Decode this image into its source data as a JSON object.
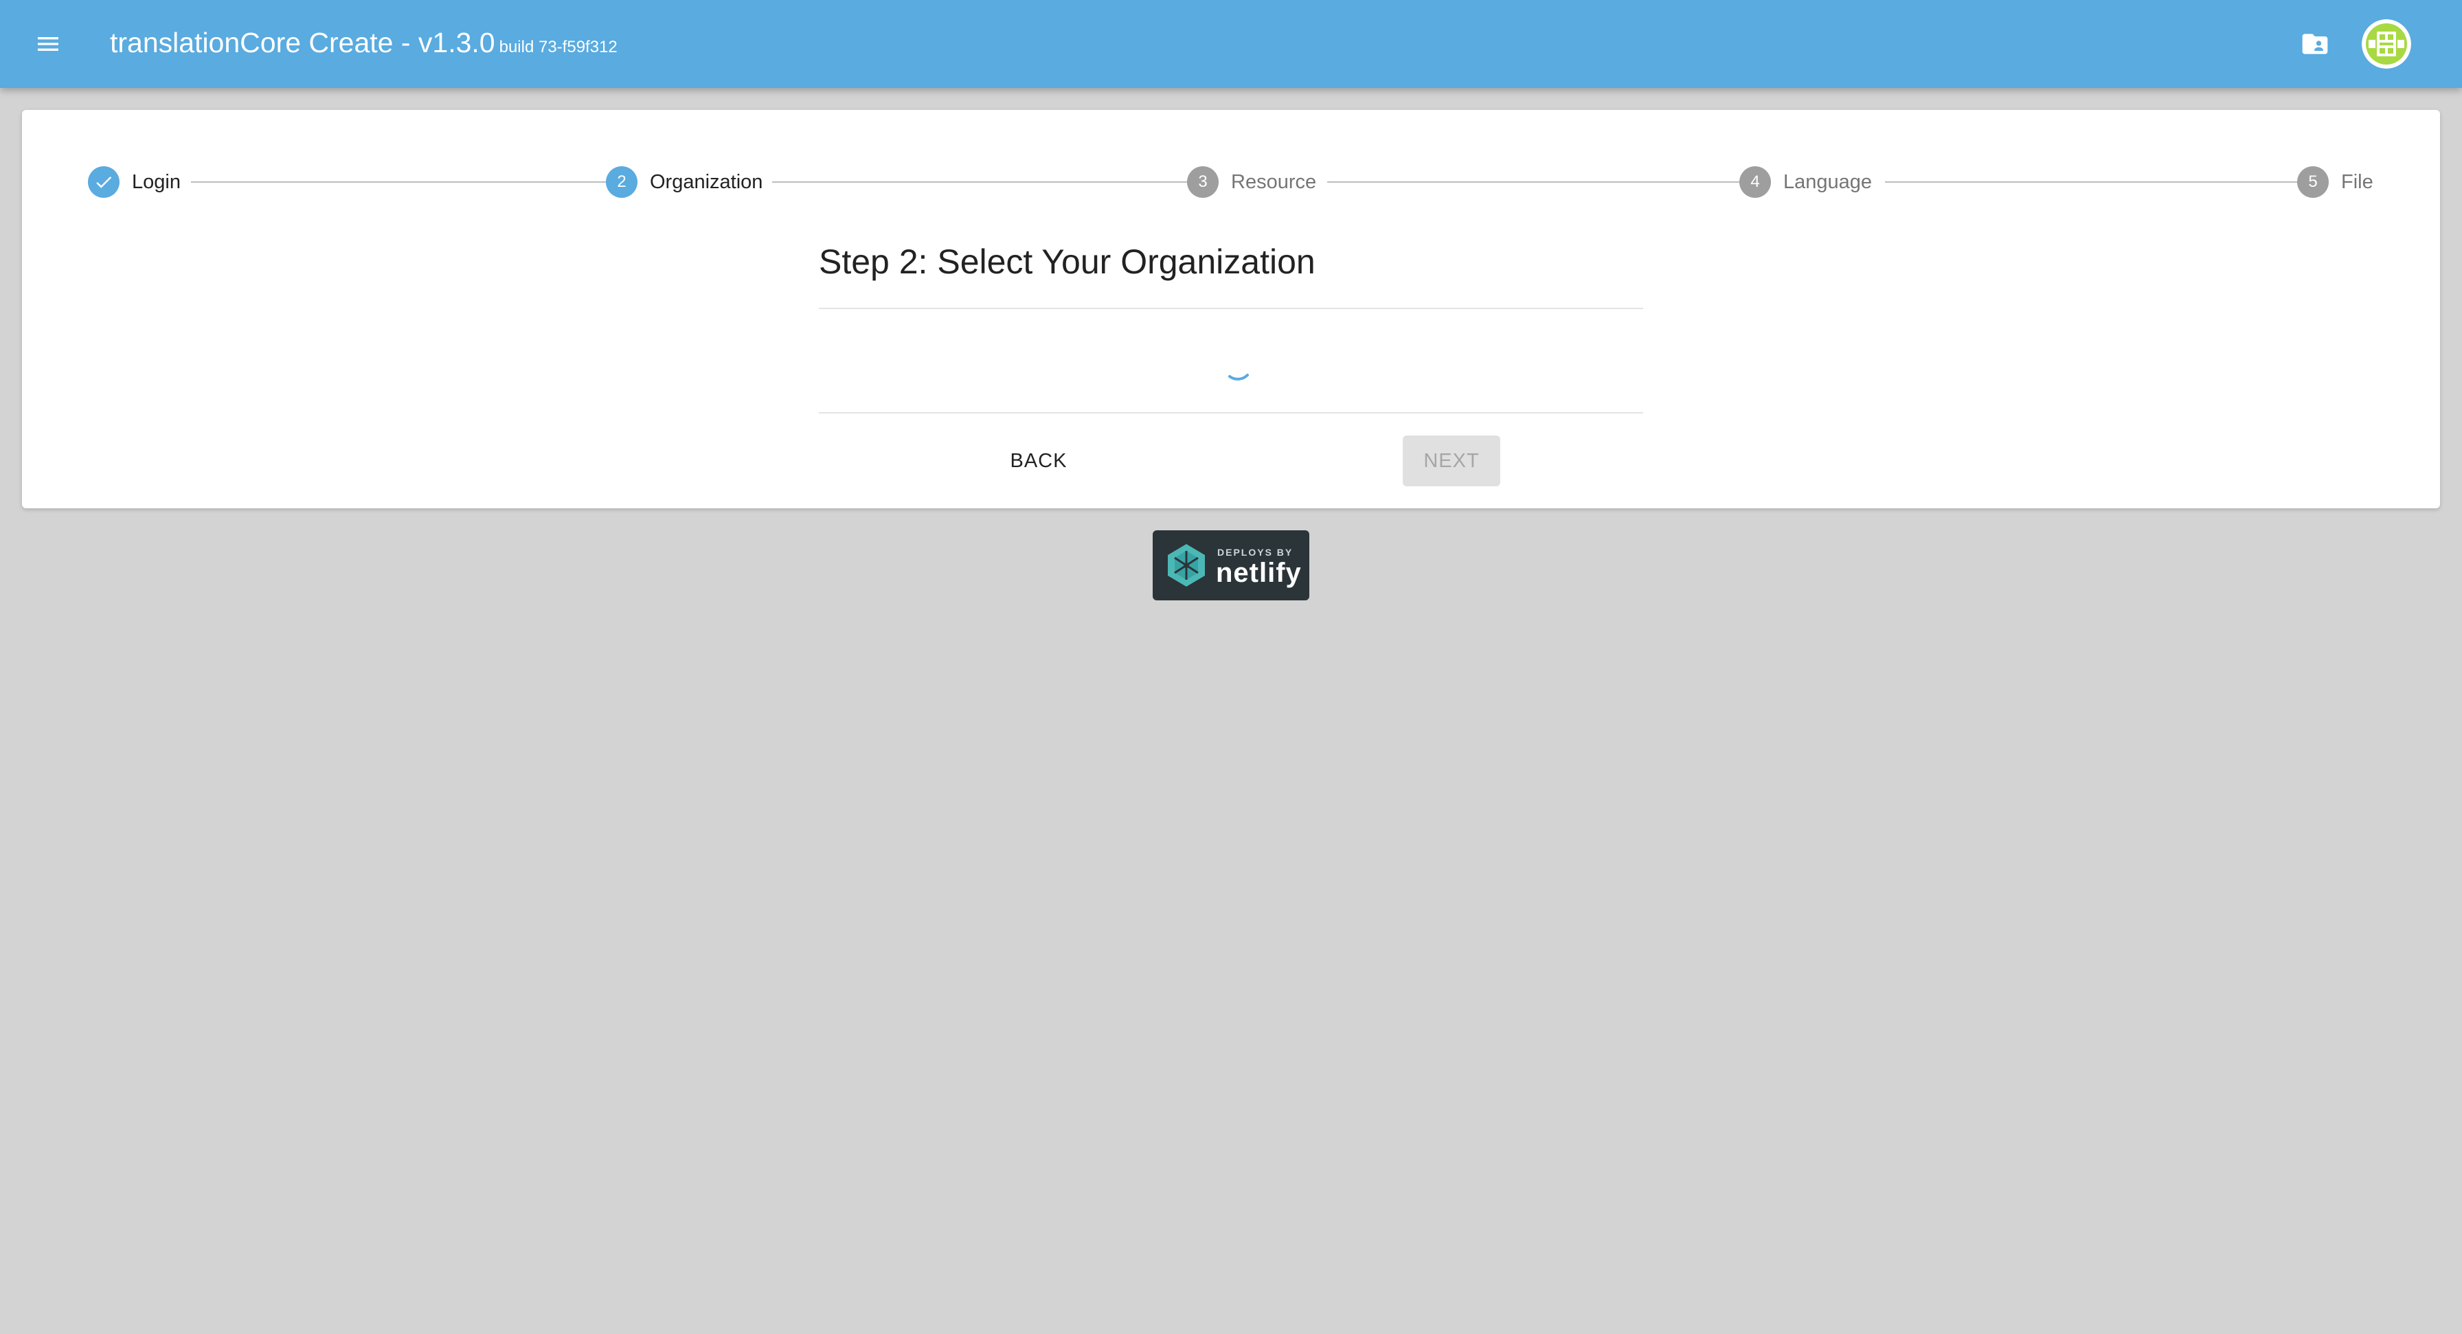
{
  "appbar": {
    "title": "translationCore Create - v1.3.0",
    "build": "build 73-f59f312",
    "menu_icon": "menu-icon",
    "folder_icon": "folder-account-icon",
    "avatar_icon": "avatar-icon",
    "color": "#59abe0"
  },
  "stepper": {
    "steps": [
      {
        "number": "",
        "label": "Login",
        "state": "completed"
      },
      {
        "number": "2",
        "label": "Organization",
        "state": "active"
      },
      {
        "number": "3",
        "label": "Resource",
        "state": "pending"
      },
      {
        "number": "4",
        "label": "Language",
        "state": "pending"
      },
      {
        "number": "5",
        "label": "File",
        "state": "pending"
      }
    ]
  },
  "content": {
    "title": "Step 2: Select Your Organization",
    "loading": true
  },
  "actions": {
    "back_label": "BACK",
    "next_label": "NEXT",
    "next_disabled": true
  },
  "badge": {
    "top_text": "DEPLOYS BY",
    "name": "netlify"
  }
}
